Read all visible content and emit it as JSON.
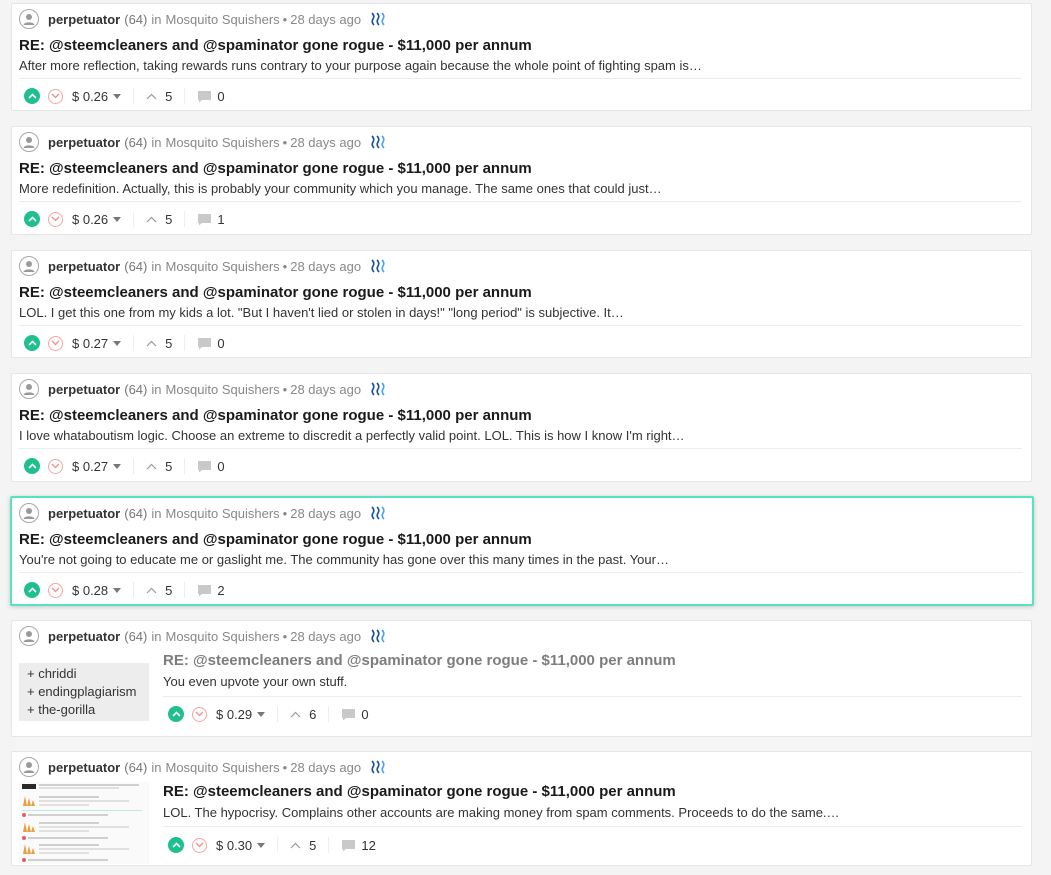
{
  "colors": {
    "upvote": "#1fbf8f",
    "downvote_border": "#f6a3a3",
    "active_border": "#57e3c1",
    "steem_blue": "#1a5099"
  },
  "icons": {
    "avatar": "user-avatar-icon",
    "steem": "steem-logo-icon",
    "upvote": "upvote-icon",
    "downvote": "downvote-icon",
    "caret": "chevron-down-icon",
    "votes": "up-arrow-icon",
    "comments": "comment-icon"
  },
  "posts": [
    {
      "author": "perpetuator",
      "reputation": "(64)",
      "in": "in",
      "community": "Mosquito Squishers",
      "dot": "•",
      "age": "28 days ago",
      "title": "RE: @steemcleaners and @spaminator gone rogue - $11,000 per annum",
      "body": "After more reflection, taking rewards runs contrary to your purpose again because the whole point of fighting spam is…",
      "payout": "$ 0.26",
      "votes": "5",
      "comments": "0"
    },
    {
      "author": "perpetuator",
      "reputation": "(64)",
      "in": "in",
      "community": "Mosquito Squishers",
      "dot": "•",
      "age": "28 days ago",
      "title": "RE: @steemcleaners and @spaminator gone rogue - $11,000 per annum",
      "body": "More redefinition. Actually, this is probably your community which you manage. The same ones that could just…",
      "payout": "$ 0.26",
      "votes": "5",
      "comments": "1"
    },
    {
      "author": "perpetuator",
      "reputation": "(64)",
      "in": "in",
      "community": "Mosquito Squishers",
      "dot": "•",
      "age": "28 days ago",
      "title": "RE: @steemcleaners and @spaminator gone rogue - $11,000 per annum",
      "body": "LOL. I get this one from my kids a lot. \"But I haven't lied or stolen in days!\" \"long period\" is subjective. It…",
      "payout": "$ 0.27",
      "votes": "5",
      "comments": "0"
    },
    {
      "author": "perpetuator",
      "reputation": "(64)",
      "in": "in",
      "community": "Mosquito Squishers",
      "dot": "•",
      "age": "28 days ago",
      "title": "RE: @steemcleaners and @spaminator gone rogue - $11,000 per annum",
      "body": "I love whataboutism logic. Choose an extreme to discredit a perfectly valid point. LOL. This is how I know I'm right…",
      "payout": "$ 0.27",
      "votes": "5",
      "comments": "0"
    },
    {
      "author": "perpetuator",
      "reputation": "(64)",
      "in": "in",
      "community": "Mosquito Squishers",
      "dot": "•",
      "age": "28 days ago",
      "title": "RE: @steemcleaners and @spaminator gone rogue - $11,000 per annum",
      "body": "You're not going to educate me or gaslight me. The community has gone over this many times in the past. Your…",
      "payout": "$ 0.28",
      "votes": "5",
      "comments": "2"
    },
    {
      "author": "perpetuator",
      "reputation": "(64)",
      "in": "in",
      "community": "Mosquito Squishers",
      "dot": "•",
      "age": "28 days ago",
      "title": "RE: @steemcleaners and @spaminator gone rogue - $11,000 per annum",
      "body": "You even upvote your own stuff.",
      "thumb_lines": [
        "+ chriddi",
        "+ endingplagiarism",
        "+ the-gorilla"
      ],
      "payout": "$ 0.29",
      "votes": "6",
      "comments": "0"
    },
    {
      "author": "perpetuator",
      "reputation": "(64)",
      "in": "in",
      "community": "Mosquito Squishers",
      "dot": "•",
      "age": "28 days ago",
      "title": "RE: @steemcleaners and @spaminator gone rogue - $11,000 per annum",
      "body": "LOL. The hypocrisy. Complains other accounts are making money from spam comments. Proceeds to do the same.…",
      "payout": "$ 0.30",
      "votes": "5",
      "comments": "12"
    }
  ]
}
